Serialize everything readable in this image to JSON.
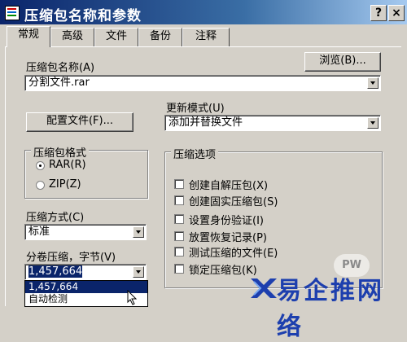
{
  "window": {
    "title": "压缩包名称和参数",
    "help_label": "?",
    "close_label": "×"
  },
  "tabs": [
    "常规",
    "高级",
    "文件",
    "备份",
    "注释"
  ],
  "archive_name": {
    "label": "压缩包名称(A)",
    "browse_label": "浏览(B)...",
    "value": "分割文件.rar"
  },
  "update_mode": {
    "label": "更新模式(U)",
    "value": "添加并替换文件"
  },
  "profiles_label": "配置文件(F)...",
  "format": {
    "title": "压缩包格式",
    "options": [
      {
        "label": "RAR(R)",
        "selected": true
      },
      {
        "label": "ZIP(Z)",
        "selected": false
      }
    ]
  },
  "compression_method": {
    "label": "压缩方式(C)",
    "value": "标准"
  },
  "volume_size": {
    "label": "分卷压缩，字节(V)",
    "value": "1,457,664",
    "dropdown_items": [
      "1,457,664",
      "自动检测"
    ]
  },
  "options": {
    "title": "压缩选项",
    "items": [
      "创建自解压包(X)",
      "创建固实压缩包(S)",
      "设置身份验证(I)",
      "放置恢复记录(P)",
      "测试压缩的文件(E)",
      "锁定压缩包(K)"
    ]
  },
  "watermark": {
    "corner_text": "PW",
    "brand_text": "易企推网络"
  },
  "colors": {
    "titlebar_start": "#0a246a",
    "titlebar_end": "#a6caf0",
    "dialog_face": "#d4d0c8",
    "selection": "#0a246a",
    "watermark": "#1d3fae"
  }
}
